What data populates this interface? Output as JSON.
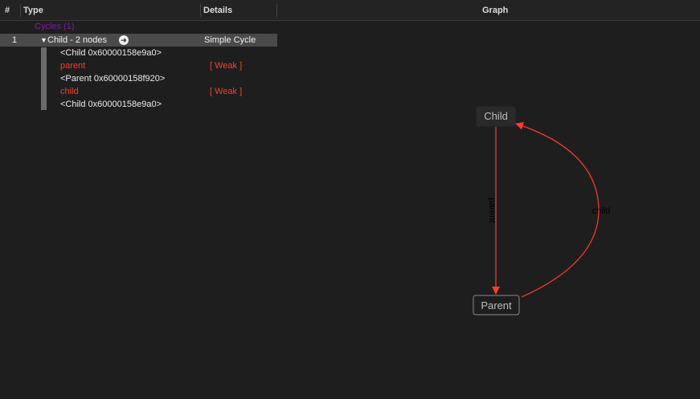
{
  "columns": {
    "index": "#",
    "type": "Type",
    "details": "Details",
    "graph": "Graph"
  },
  "cycles_group": "Cycles (1)",
  "cycle": {
    "index": "1",
    "label": "Child - 2 nodes",
    "details": "Simple Cycle"
  },
  "chain": [
    {
      "kind": "object",
      "text": "<Child 0x60000158e9a0>"
    },
    {
      "kind": "reference",
      "text": "parent",
      "detail": "[ Weak ]"
    },
    {
      "kind": "object",
      "text": "<Parent 0x60000158f920>"
    },
    {
      "kind": "reference",
      "text": "child",
      "detail": "[ Weak ]"
    },
    {
      "kind": "object",
      "text": "<Child 0x60000158e9a0>"
    }
  ],
  "graph": {
    "nodes": {
      "top": "Child",
      "bottom": "Parent"
    },
    "edges": {
      "down": "parent",
      "up": "child"
    },
    "edge_color": "#ff3b30"
  }
}
